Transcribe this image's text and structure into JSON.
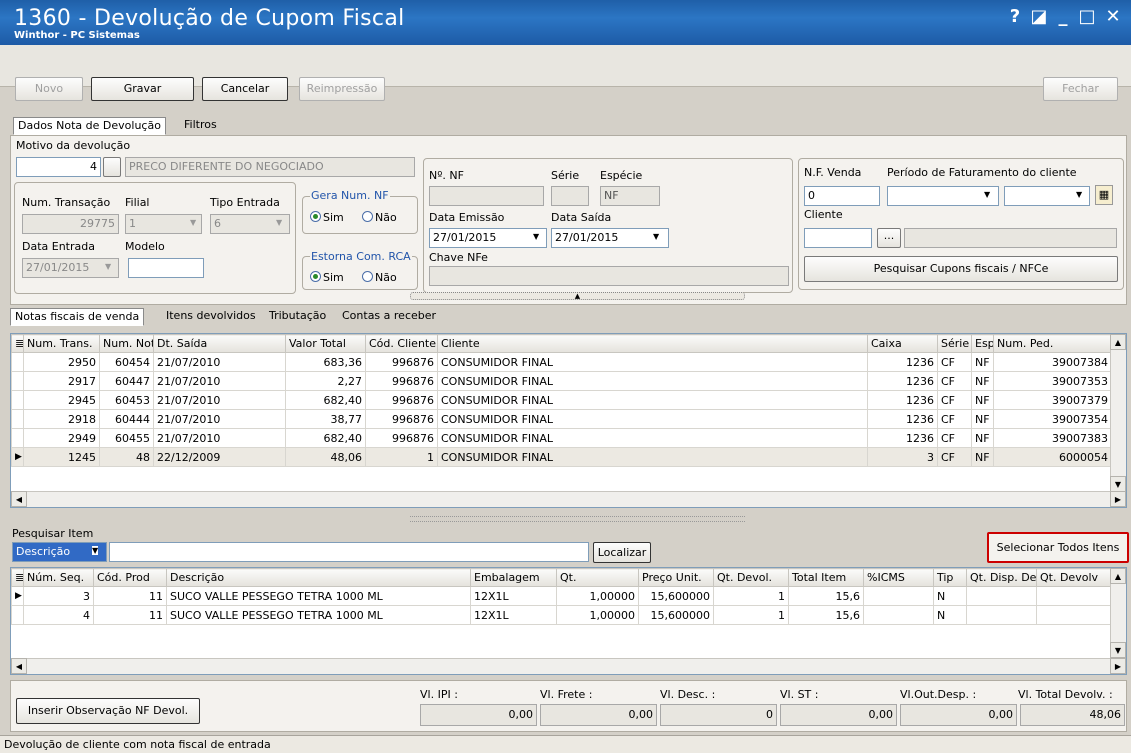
{
  "window": {
    "title": "1360 - Devolução de Cupom Fiscal",
    "subtitle": "Winthor - PC Sistemas",
    "controls": [
      "?",
      "◪",
      "_",
      "□",
      "✕"
    ]
  },
  "toolbar": {
    "novo": "Novo",
    "gravar": "Gravar",
    "cancelar": "Cancelar",
    "reimpressao": "Reimpressão",
    "fechar": "Fechar"
  },
  "tabs_top": [
    "Dados Nota de Devolução",
    "Filtros"
  ],
  "form": {
    "motivo_label": "Motivo da devolução",
    "motivo_code": "4",
    "motivo_desc": "PRECO DIFERENTE DO NEGOCIADO",
    "num_transacao_label": "Num. Transação",
    "num_transacao": "29775",
    "filial_label": "Filial",
    "filial": "1",
    "tipo_entrada_label": "Tipo Entrada",
    "tipo_entrada": "6",
    "data_entrada_label": "Data Entrada",
    "data_entrada": "27/01/2015",
    "modelo_label": "Modelo",
    "modelo": "",
    "gera_num_nf_label": "Gera Num. NF",
    "estorna_label": "Estorna Com. RCA",
    "sim": "Sim",
    "nao": "Não",
    "nf_label": "Nº. NF",
    "serie_label": "Série",
    "especie_label": "Espécie",
    "especie": "NF",
    "data_emissao_label": "Data Emissão",
    "data_emissao": "27/01/2015",
    "data_saida_label": "Data Saída",
    "data_saida": "27/01/2015",
    "chave_nfe_label": "Chave NFe",
    "nf_venda_label": "N.F. Venda",
    "nf_venda": "0",
    "periodo_label": "Período de Faturamento do cliente",
    "cliente_label": "Cliente",
    "ellipsis": "...",
    "pesquisar_cupons": "Pesquisar Cupons fiscais / NFCe"
  },
  "tabs_mid": [
    "Notas fiscais de venda",
    "Itens devolvidos",
    "Tributação",
    "Contas a receber"
  ],
  "notas": {
    "headers": [
      "Num. Trans.",
      "Num. Nota",
      "Dt. Saída",
      "Valor Total",
      "Cód. Cliente",
      "Cliente",
      "Caixa",
      "Série",
      "Esp",
      "Num. Ped."
    ],
    "rows": [
      [
        "2950",
        "60454",
        "21/07/2010",
        "683,36",
        "996876",
        "CONSUMIDOR FINAL",
        "1236",
        "CF",
        "NF",
        "39007384"
      ],
      [
        "2917",
        "60447",
        "21/07/2010",
        "2,27",
        "996876",
        "CONSUMIDOR FINAL",
        "1236",
        "CF",
        "NF",
        "39007353"
      ],
      [
        "2945",
        "60453",
        "21/07/2010",
        "682,40",
        "996876",
        "CONSUMIDOR FINAL",
        "1236",
        "CF",
        "NF",
        "39007379"
      ],
      [
        "2918",
        "60444",
        "21/07/2010",
        "38,77",
        "996876",
        "CONSUMIDOR FINAL",
        "1236",
        "CF",
        "NF",
        "39007354"
      ],
      [
        "2949",
        "60455",
        "21/07/2010",
        "682,40",
        "996876",
        "CONSUMIDOR FINAL",
        "1236",
        "CF",
        "NF",
        "39007383"
      ],
      [
        "1245",
        "48",
        "22/12/2009",
        "48,06",
        "1",
        "CONSUMIDOR FINAL",
        "3",
        "CF",
        "NF",
        "6000054"
      ]
    ]
  },
  "pesquisa": {
    "label": "Pesquisar Item",
    "select": "Descrição",
    "localizar": "Localizar",
    "selecionar_todos": "Selecionar Todos Itens"
  },
  "itens": {
    "headers": [
      "Núm. Seq.",
      "Cód. Prod",
      "Descrição",
      "Embalagem",
      "Qt.",
      "Preço Unit.",
      "Qt. Devol.",
      "Total Item",
      "%ICMS",
      "Tip",
      "Qt. Disp. De",
      "Qt. Devolv"
    ],
    "rows": [
      [
        "3",
        "11",
        "SUCO VALLE PESSEGO TETRA 1000 ML",
        "12X1L",
        "1,00000",
        "15,600000",
        "1",
        "15,6",
        "",
        "N",
        "",
        ""
      ],
      [
        "4",
        "11",
        "SUCO VALLE PESSEGO TETRA 1000 ML",
        "12X1L",
        "1,00000",
        "15,600000",
        "1",
        "15,6",
        "",
        "N",
        "",
        ""
      ]
    ]
  },
  "footer": {
    "inserir_obs": "Inserir Observação NF Devol.",
    "vl_ipi_label": "Vl. IPI :",
    "vl_ipi": "0,00",
    "vl_frete_label": "Vl. Frete :",
    "vl_frete": "0,00",
    "vl_desc_label": "Vl. Desc. :",
    "vl_desc": "0",
    "vl_st_label": "Vl. ST :",
    "vl_st": "0,00",
    "vl_out_label": "Vl.Out.Desp. :",
    "vl_out": "0,00",
    "vl_total_label": "Vl. Total Devolv. :",
    "vl_total": "48,06"
  },
  "status": "Devolução de cliente com nota fiscal de entrada",
  "colors": {
    "title_bar": "#2c76c4",
    "highlight_border": "#cc0000",
    "selection": "#316ac5"
  }
}
